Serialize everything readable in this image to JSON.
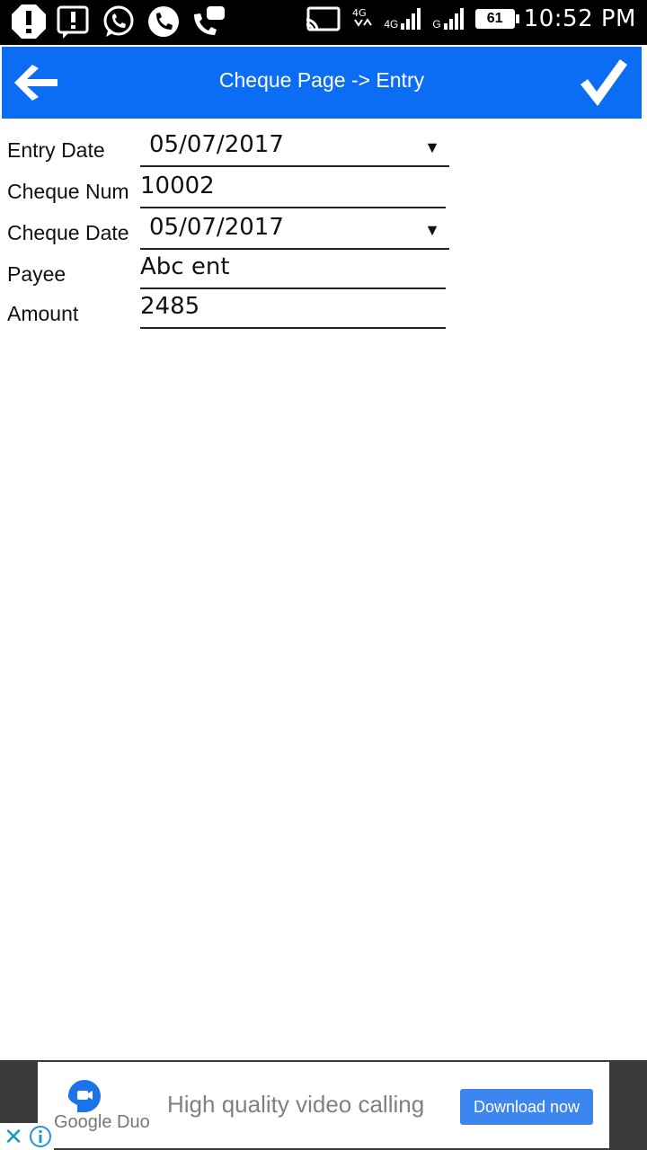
{
  "status_bar": {
    "time": "10:52 PM",
    "battery": "61",
    "network_1": "4G",
    "network_2": "G",
    "icons": [
      "alert-octagon-icon",
      "alert-box-icon",
      "whatsapp-icon",
      "phone-icon",
      "chat-phone-icon",
      "cast-icon",
      "volte-icon",
      "signal-icon",
      "signal-icon",
      "battery-icon"
    ]
  },
  "app_bar": {
    "title": "Cheque Page -> Entry",
    "back_icon": "arrow-left-icon",
    "confirm_icon": "check-icon",
    "color": "#0b6df3"
  },
  "form": {
    "entry_date": {
      "label": "Entry Date",
      "value": "05/07/2017"
    },
    "cheque_num": {
      "label": "Cheque Num",
      "value": "10002"
    },
    "cheque_date": {
      "label": "Cheque Date",
      "value": "05/07/2017"
    },
    "payee": {
      "label": "Payee",
      "value": "Abc ent"
    },
    "amount": {
      "label": "Amount",
      "value": "2485"
    },
    "dropdown_caret": "▼"
  },
  "ad": {
    "brand": "Google Duo",
    "headline": "High quality video calling",
    "cta": "Download now",
    "close_glyph": "✕",
    "cta_color": "#3d86f0"
  }
}
